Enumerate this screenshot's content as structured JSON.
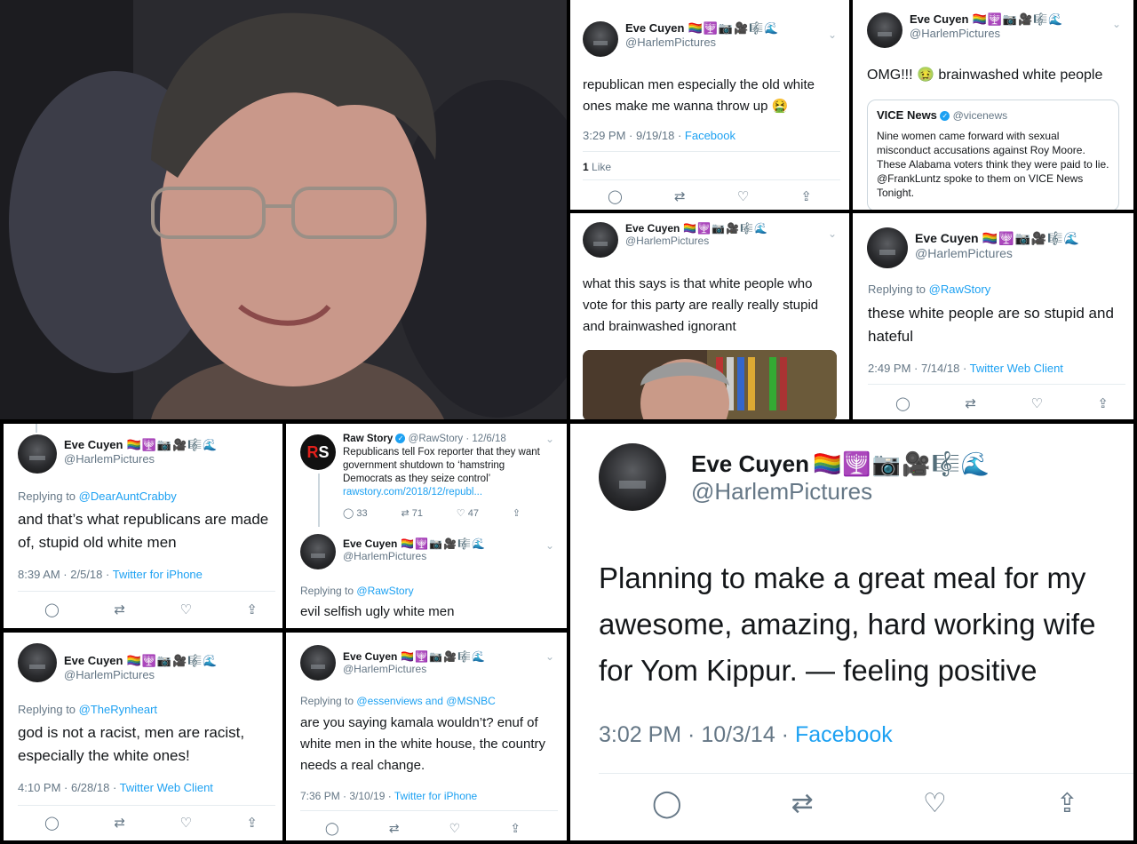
{
  "profile": {
    "name": "Eve Cuyen",
    "emojis": "🏳️‍🌈🕎📷🎥🎼🌊",
    "handle": "@HarlemPictures"
  },
  "tweet1": {
    "text": "republican men especially the old white ones make me wanna throw up 🤮",
    "time": "3:29 PM · 9/19/18 ·",
    "source": "Facebook",
    "likes": "1",
    "likes_label": "Like"
  },
  "tweet2": {
    "text": "OMG!!! 🤢 brainwashed white people",
    "quote_name": "VICE News",
    "quote_handle": "@vicenews",
    "quote_text": "Nine women came forward with sexual misconduct accusations against Roy Moore. These Alabama voters think they were paid to lie. @FrankLuntz spoke to them on VICE News Tonight."
  },
  "tweet3": {
    "text": "what this says is that white people who vote for this party are really really stupid and brainwashed ignorant"
  },
  "tweet4": {
    "replying_prefix": "Replying to",
    "replying_to": "@RawStory",
    "text": "these white people are so stupid and hateful",
    "time": "2:49 PM · 7/14/18 ·",
    "source": "Twitter Web Client"
  },
  "tweet5": {
    "replying_prefix": "Replying to",
    "replying_to": "@DearAuntCrabby",
    "text": "and that’s what republicans are made of, stupid old white men",
    "time": "8:39 AM · 2/5/18 ·",
    "source": "Twitter for iPhone"
  },
  "tweet6": {
    "rs_name": "Raw Story",
    "rs_handle": "@RawStory · 12/6/18",
    "rs_text": "Republicans tell Fox reporter that they want government shutdown to ‘hamstring Democrats as they seize control’",
    "rs_link": "rawstory.com/2018/12/republ...",
    "replies": "33",
    "retweets": "71",
    "likes": "47",
    "replying_prefix": "Replying to",
    "replying_to": "@RawStory",
    "text": "evil selfish ugly white men"
  },
  "tweet7": {
    "replying_prefix": "Replying to",
    "replying_to": "@TheRynheart",
    "text": "god is not a racist, men are racist, especially the white ones!",
    "time": "4:10 PM · 6/28/18 ·",
    "source": "Twitter Web Client"
  },
  "tweet8": {
    "replying_prefix": "Replying to",
    "replying_to": "@essenviews and @MSNBC",
    "text": "are you saying kamala wouldn’t? enuf of white men in the white house, the country needs a real change.",
    "time": "7:36 PM · 3/10/19 ·",
    "source": "Twitter for iPhone"
  },
  "tweet9": {
    "text": "Planning to make a great meal for my awesome, amazing, hard working wife for Yom Kippur. — feeling positive",
    "time": "3:02 PM · 10/3/14 ·",
    "source": "Facebook"
  },
  "icons": {
    "reply": "reply-icon",
    "retweet": "retweet-icon",
    "like": "heart-icon",
    "share": "share-icon",
    "chevron": "chevron-down-icon"
  },
  "colors": {
    "link": "#1da1f2",
    "muted": "#657786",
    "text": "#14171a"
  }
}
